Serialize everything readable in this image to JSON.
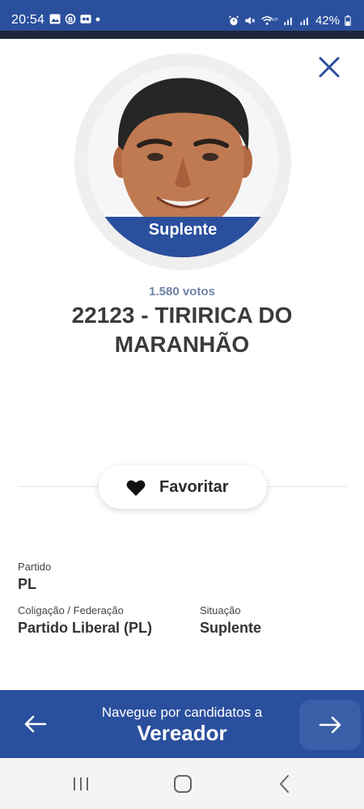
{
  "status_bar": {
    "time": "20:54",
    "battery": "42%",
    "left_icons": [
      "image-icon",
      "b-badge-icon",
      "dual-app-icon",
      "dot-icon"
    ],
    "right_icons": [
      "alarm-icon",
      "mute-icon",
      "wifi-icon",
      "signal-icon",
      "signal-icon",
      "battery-icon"
    ]
  },
  "candidate": {
    "status": "Suplente",
    "votes": "1.580 votos",
    "name": "22123 - TIRIRICA DO MARANHÃO"
  },
  "actions": {
    "favorite_label": "Favoritar"
  },
  "details": {
    "party_label": "Partido",
    "party_value": "PL",
    "coalition_label": "Coligação / Federação",
    "coalition_value": "Partido Liberal (PL)",
    "situation_label": "Situação",
    "situation_value": "Suplente"
  },
  "navigation": {
    "line1": "Navegue por candidatos a",
    "line2": "Vereador"
  },
  "colors": {
    "brand_blue": "#2a4f9d",
    "votes_gray_blue": "#6f83a8",
    "text_dark": "#333333"
  }
}
